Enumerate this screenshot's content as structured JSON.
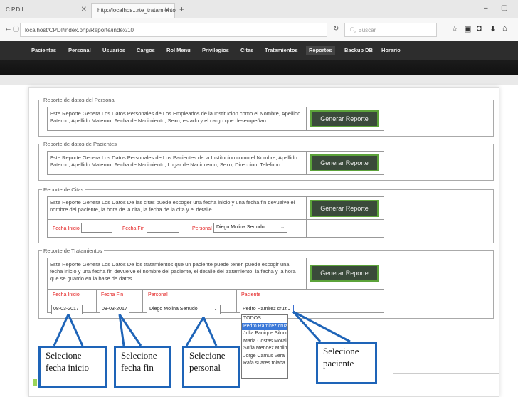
{
  "browser": {
    "tabs": [
      {
        "title": "C.P.D.I"
      },
      {
        "title": "http://localhos...rte_tratamiento"
      }
    ],
    "url": "localhost/CPDI/index.php/Reporte/index/10",
    "search_placeholder": "Buscar"
  },
  "nav": {
    "items": [
      "Pacientes",
      "Personal",
      "Usuarios",
      "Cargos",
      "Rol Menu",
      "Privilegios",
      "Citas",
      "Tratamientos",
      "Reportes",
      "Backup DB",
      "Horario"
    ],
    "active": "Reportes"
  },
  "reports": {
    "personal": {
      "legend": "Reporte de datos del Personal",
      "description": "Este Reporte Genera Los Datos Personales de Los Empleados de la Institucion como el Nombre, Apellido Paterno, Apellido Materno, Fecha de Nacimiento, Sexo, estado y el cargo que desempeñan.",
      "button": "Generar Reporte"
    },
    "pacientes": {
      "legend": "Reporte de datos de Pacientes",
      "description": "Este Reporte Genera Los Datos Personales de Los Pacientes de la Institucion como el Nombre, Apellido Paterno, Apellido Materno, Fecha de Nacimiento, Lugar de Nacimiento, Sexo, Direccion, Telefono",
      "button": "Generar Reporte"
    },
    "citas": {
      "legend": "Reporte de Citas",
      "description": "Este Reporte Genera Los Datos De las citas puede escoger una fecha inicio y una fecha fin devuelve el nombre del paciente, la hora de la cita, la fecha de la cita y el detalle",
      "button": "Generar Reporte",
      "fecha_inicio_label": "Fecha Inicio",
      "fecha_inicio_value": "",
      "fecha_fin_label": "Fecha Fin",
      "fecha_fin_value": "",
      "personal_label": "Personal",
      "personal_value": "Diego Molina Serrudo"
    },
    "tratamientos": {
      "legend": "Reporte de Tratamientos",
      "description": "Este Reporte Genera Los Datos De los tratamientos que un paciente puede tener, puede escogir una fecha inicio y una fecha fin devuelve el nombre del paciente, el detalle del tratamiento, la fecha y la hora que se guardo en la base de datos",
      "button": "Generar Reporte",
      "fecha_inicio_label": "Fecha Inicio",
      "fecha_inicio_value": "08-03-2017",
      "fecha_fin_label": "Fecha Fin",
      "fecha_fin_value": "08-03-2017",
      "personal_label": "Personal",
      "personal_value": "Diego Molina Serrudo",
      "paciente_label": "Paciente",
      "paciente_value": "Pedro Ramirez cruz",
      "paciente_options": [
        "TODOS",
        "Pedro Ramirez cruz",
        "Julia Panique Siloco",
        "Maria Costas Morales",
        "Sofia Mendez Molina",
        "Jorge Camus Vera",
        "Rafa suares tolaba"
      ],
      "paciente_selected_index": 1
    }
  },
  "callouts": {
    "fecha_inicio": "Selecione fecha inicio",
    "fecha_fin": "Selecione fecha fin",
    "personal": "Selecione personal",
    "paciente": "Selecione paciente"
  },
  "colors": {
    "callout_border": "#1e64b8",
    "button_border": "#5ca33a",
    "field_label": "#e32020"
  }
}
